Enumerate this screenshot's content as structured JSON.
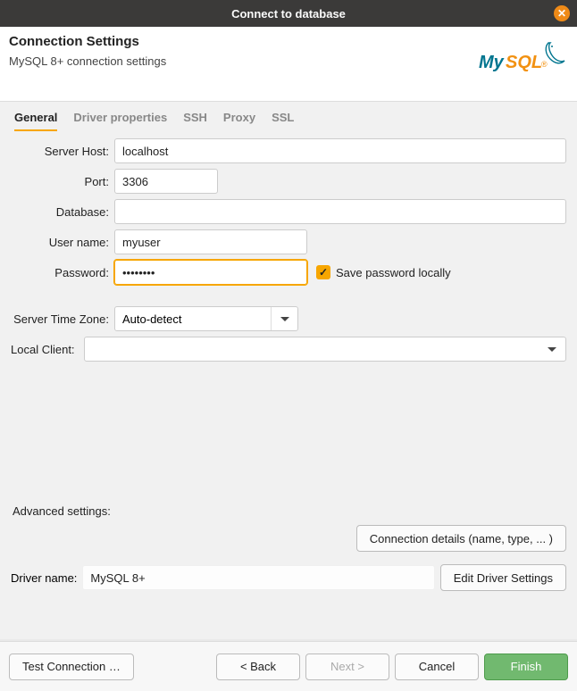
{
  "title": "Connect to database",
  "header": {
    "title": "Connection Settings",
    "subtitle": "MySQL 8+ connection settings"
  },
  "tabs": {
    "general": "General",
    "driver": "Driver properties",
    "ssh": "SSH",
    "proxy": "Proxy",
    "ssl": "SSL"
  },
  "labels": {
    "host": "Server Host:",
    "port": "Port:",
    "db": "Database:",
    "user": "User name:",
    "pwd": "Password:",
    "save_pwd": "Save password locally",
    "tz": "Server Time Zone:",
    "local": "Local Client:",
    "advanced": "Advanced settings:",
    "driver_name": "Driver name:"
  },
  "values": {
    "host": "localhost",
    "port": "3306",
    "db": "",
    "user": "myuser",
    "pwd": "••••••••",
    "tz": "Auto-detect",
    "local": "",
    "driver_name": "MySQL 8+"
  },
  "buttons": {
    "conn_details": "Connection details (name, type, ... )",
    "edit_driver": "Edit Driver Settings",
    "test": "Test Connection …",
    "back": "< Back",
    "next": "Next >",
    "cancel": "Cancel",
    "finish": "Finish"
  }
}
